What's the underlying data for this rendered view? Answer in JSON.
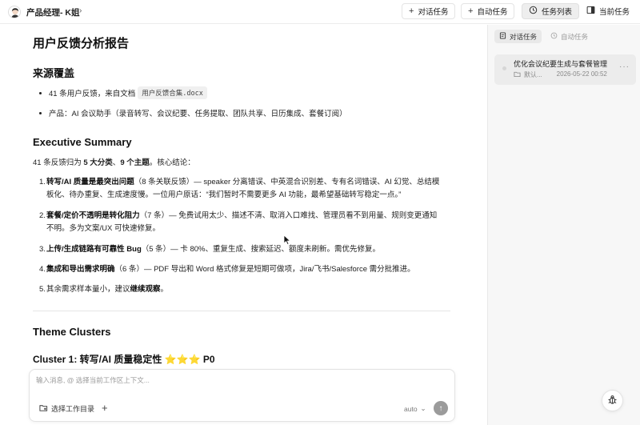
{
  "header": {
    "title": "产品经理- K姐",
    "buttons": {
      "conversation_task": "对话任务",
      "auto_task": "自动任务",
      "task_list": "任务列表",
      "current_task": "当前任务"
    }
  },
  "document": {
    "title": "用户反馈分析报告",
    "source_heading": "来源覆盖",
    "source_bullets": {
      "b1_text": "41 条用户反馈，来自文档",
      "b1_file": "用户反馈合集.docx",
      "b2_text": "产品：AI 会议助手（录音转写、会议纪要、任务提取、团队共享、日历集成、套餐订阅）"
    },
    "summary_heading": "Executive Summary",
    "summary_intro": {
      "pre": "41 条反馈归为 ",
      "bold1": "5 大分类",
      "mid": "、",
      "bold2": "9 个主题",
      "post": "。核心结论："
    },
    "summary_items": [
      {
        "num": "1.",
        "bold": "转写/AI 质量是最突出问题",
        "text": "（8 条关联反馈）— speaker 分离错误、中英混合识别差、专有名词错误、AI 幻觉、总结模板化、待办重复、生成速度慢。一位用户原话：“我们暂时不需要更多 AI 功能，最希望基础转写稳定一点。”"
      },
      {
        "num": "2.",
        "bold": "套餐/定价不透明是转化阻力",
        "text": "（7 条）— 免费试用太少、描述不清、取消入口难找、管理员看不到用量、规则变更通知不明。多为文案/UX 可快速修复。"
      },
      {
        "num": "3.",
        "bold": "上传/生成链路有可靠性 Bug",
        "text": "（5 条）— 卡 80%、重复生成、搜索延迟、额度未刷新。需优先修复。"
      },
      {
        "num": "4.",
        "bold": "集成和导出需求明确",
        "text": "（6 条）— PDF 导出和 Word 格式修复是短期可做项，Jira/飞书/Salesforce 需分批推进。"
      },
      {
        "num": "5.",
        "pre": "其余需求样本量小，建议",
        "bold": "继续观察",
        "text": "。"
      }
    ],
    "clusters_heading": "Theme Clusters",
    "cluster1_heading": "Cluster 1: 转写/AI 质量稳定性 ⭐⭐⭐ P0"
  },
  "composer": {
    "placeholder": "输入消息, @ 选择当前工作区上下文...",
    "workspace_label": "选择工作目录",
    "model": "auto"
  },
  "right_panel": {
    "tabs": {
      "conversation": "对话任务",
      "auto": "自动任务"
    },
    "task": {
      "title": "优化会议纪要生成与套餐管理",
      "folder": "默认...",
      "time": "2026-05-22 00:52"
    }
  }
}
